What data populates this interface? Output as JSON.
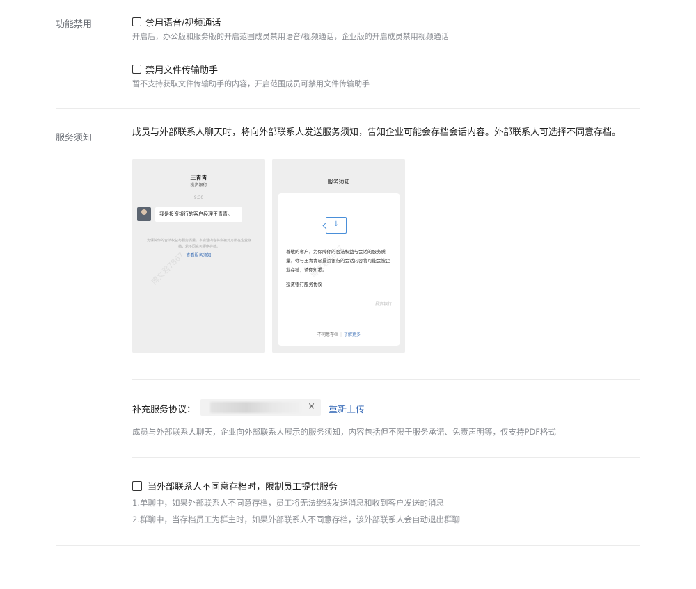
{
  "feature_disable": {
    "section_label": "功能禁用",
    "voice_video": {
      "label": "禁用语音/视频通话",
      "description": "开启后，办公版和服务版的开启范围成员禁用语音/视频通话，企业版的开启成员禁用视频通话"
    },
    "file_helper": {
      "label": "禁用文件传输助手",
      "description": "暂不支持获取文件传输助手的内容，开启范围成员可禁用文件传输助手"
    }
  },
  "service_notice": {
    "section_label": "服务须知",
    "paragraph": "成员与外部联系人聊天时，将向外部联系人发送服务须知，告知企业可能会存档会话内容。外部联系人可选择不同意存档。",
    "preview_chat": {
      "contact_name": "王青青",
      "contact_company": "投资银行",
      "time": "9:30",
      "message": "我是投资银行的客户经理王青青。",
      "notice": "为保障你的合法权益与服务质量，本会话内容将会被对方所在企业存档，若不同意可拒绝存档。",
      "notice_link": "查看服务须知",
      "watermark": "博文君7867"
    },
    "preview_notice": {
      "title": "服务须知",
      "body": "尊敬的客户，为保障你的合法权益与会话的服务质量，你与王青青@投资银行的会话内容将可能会被企业存档，请你知悉。",
      "agreement_link": "投资银行服务协议",
      "bank": "投资银行",
      "decline": "不同意存档",
      "separator": "|",
      "learn_more": "了解更多",
      "watermark": "博文君7867"
    }
  },
  "supplementary": {
    "label": "补充服务协议：",
    "remove_icon": "close-icon",
    "remove_glyph": "×",
    "reupload": "重新上传",
    "description": "成员与外部联系人聊天，企业向外部联系人展示的服务须知，内容包括但不限于服务承诺、免责声明等，仅支持PDF格式"
  },
  "restrict_service": {
    "label": "当外部联系人不同意存档时，限制员工提供服务",
    "line1": "1.单聊中，如果外部联系人不同意存档，员工将无法继续发送消息和收到客户发送的消息",
    "line2": "2.群聊中，当存档员工为群主时，如果外部联系人不同意存档，该外部联系人会自动退出群聊"
  },
  "colors": {
    "link": "#2f64b4",
    "muted_text": "#8a8d93",
    "divider": "#ebebeb"
  }
}
